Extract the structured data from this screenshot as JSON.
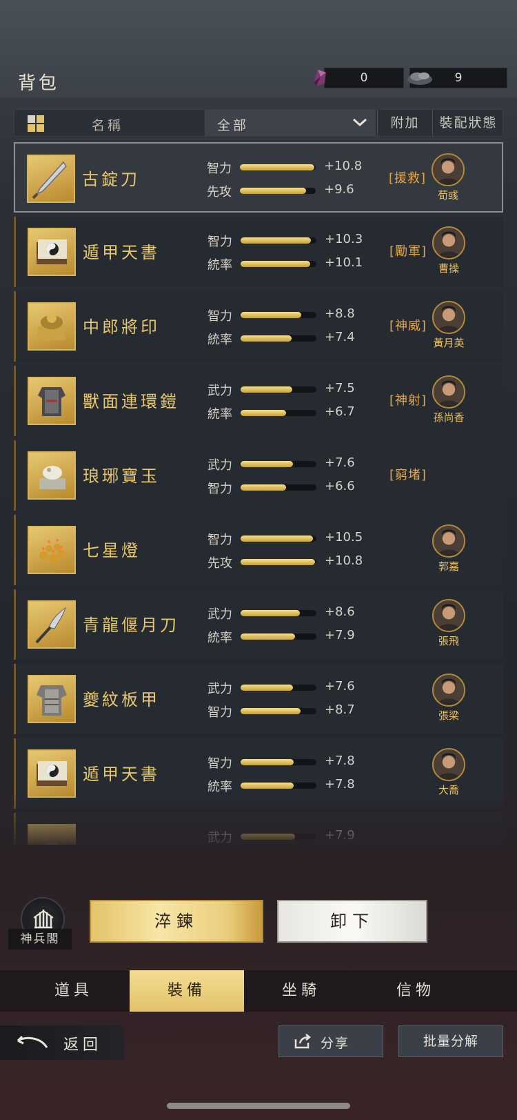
{
  "header": {
    "title": "背包",
    "gem_count": "0",
    "ore_count": "9"
  },
  "filter": {
    "sort_label": "名稱",
    "category": "全部",
    "extra_label": "附加",
    "state_label": "裝配狀態"
  },
  "items": [
    {
      "name": "古錠刀",
      "stat1_label": "智力",
      "stat1_value": "+10.8",
      "stat1_fill": 0.98,
      "stat2_label": "先攻",
      "stat2_value": "+9.6",
      "stat2_fill": 0.87,
      "tag": "[援救]",
      "hero": "荀彧",
      "icon": "blade-icon",
      "selected": true
    },
    {
      "name": "遁甲天書",
      "stat1_label": "智力",
      "stat1_value": "+10.3",
      "stat1_fill": 0.93,
      "stat2_label": "統率",
      "stat2_value": "+10.1",
      "stat2_fill": 0.92,
      "tag": "[勵軍]",
      "hero": "曹操",
      "icon": "book-icon"
    },
    {
      "name": "中郎將印",
      "stat1_label": "智力",
      "stat1_value": "+8.8",
      "stat1_fill": 0.8,
      "stat2_label": "統率",
      "stat2_value": "+7.4",
      "stat2_fill": 0.67,
      "tag": "[神威]",
      "hero": "黃月英",
      "icon": "seal-icon"
    },
    {
      "name": "獸面連環鎧",
      "stat1_label": "武力",
      "stat1_value": "+7.5",
      "stat1_fill": 0.68,
      "stat2_label": "統率",
      "stat2_value": "+6.7",
      "stat2_fill": 0.6,
      "tag": "[神射]",
      "hero": "孫尚香",
      "icon": "armor-icon"
    },
    {
      "name": "琅琊寶玉",
      "stat1_label": "武力",
      "stat1_value": "+7.6",
      "stat1_fill": 0.69,
      "stat2_label": "智力",
      "stat2_value": "+6.6",
      "stat2_fill": 0.6,
      "tag": "[窮堵]",
      "hero": "",
      "icon": "jade-icon"
    },
    {
      "name": "七星燈",
      "stat1_label": "智力",
      "stat1_value": "+10.5",
      "stat1_fill": 0.95,
      "stat2_label": "先攻",
      "stat2_value": "+10.8",
      "stat2_fill": 0.98,
      "tag": "",
      "hero": "郭嘉",
      "icon": "lamp-icon"
    },
    {
      "name": "青龍偃月刀",
      "stat1_label": "武力",
      "stat1_value": "+8.6",
      "stat1_fill": 0.78,
      "stat2_label": "統率",
      "stat2_value": "+7.9",
      "stat2_fill": 0.72,
      "tag": "",
      "hero": "張飛",
      "icon": "glaive-icon"
    },
    {
      "name": "夔紋板甲",
      "stat1_label": "武力",
      "stat1_value": "+7.6",
      "stat1_fill": 0.69,
      "stat2_label": "智力",
      "stat2_value": "+8.7",
      "stat2_fill": 0.79,
      "tag": "",
      "hero": "張梁",
      "icon": "plate-armor-icon"
    },
    {
      "name": "遁甲天書",
      "stat1_label": "智力",
      "stat1_value": "+7.8",
      "stat1_fill": 0.7,
      "stat2_label": "統率",
      "stat2_value": "+7.8",
      "stat2_fill": 0.7,
      "tag": "",
      "hero": "大喬",
      "icon": "book-icon"
    },
    {
      "name": "",
      "stat1_label": "武力",
      "stat1_value": "+7.9",
      "stat1_fill": 0.72,
      "stat2_label": "",
      "stat2_value": "",
      "stat2_fill": 0,
      "tag": "",
      "hero": "",
      "icon": "orb-icon"
    }
  ],
  "actions": {
    "forge_label": "神兵閣",
    "refine_label": "淬鍊",
    "unequip_label": "卸下"
  },
  "tabs": [
    "道具",
    "裝備",
    "坐騎",
    "信物"
  ],
  "active_tab": 1,
  "footer": {
    "back_label": "返回",
    "share_label": "分享",
    "batch_label": "批量分解"
  }
}
